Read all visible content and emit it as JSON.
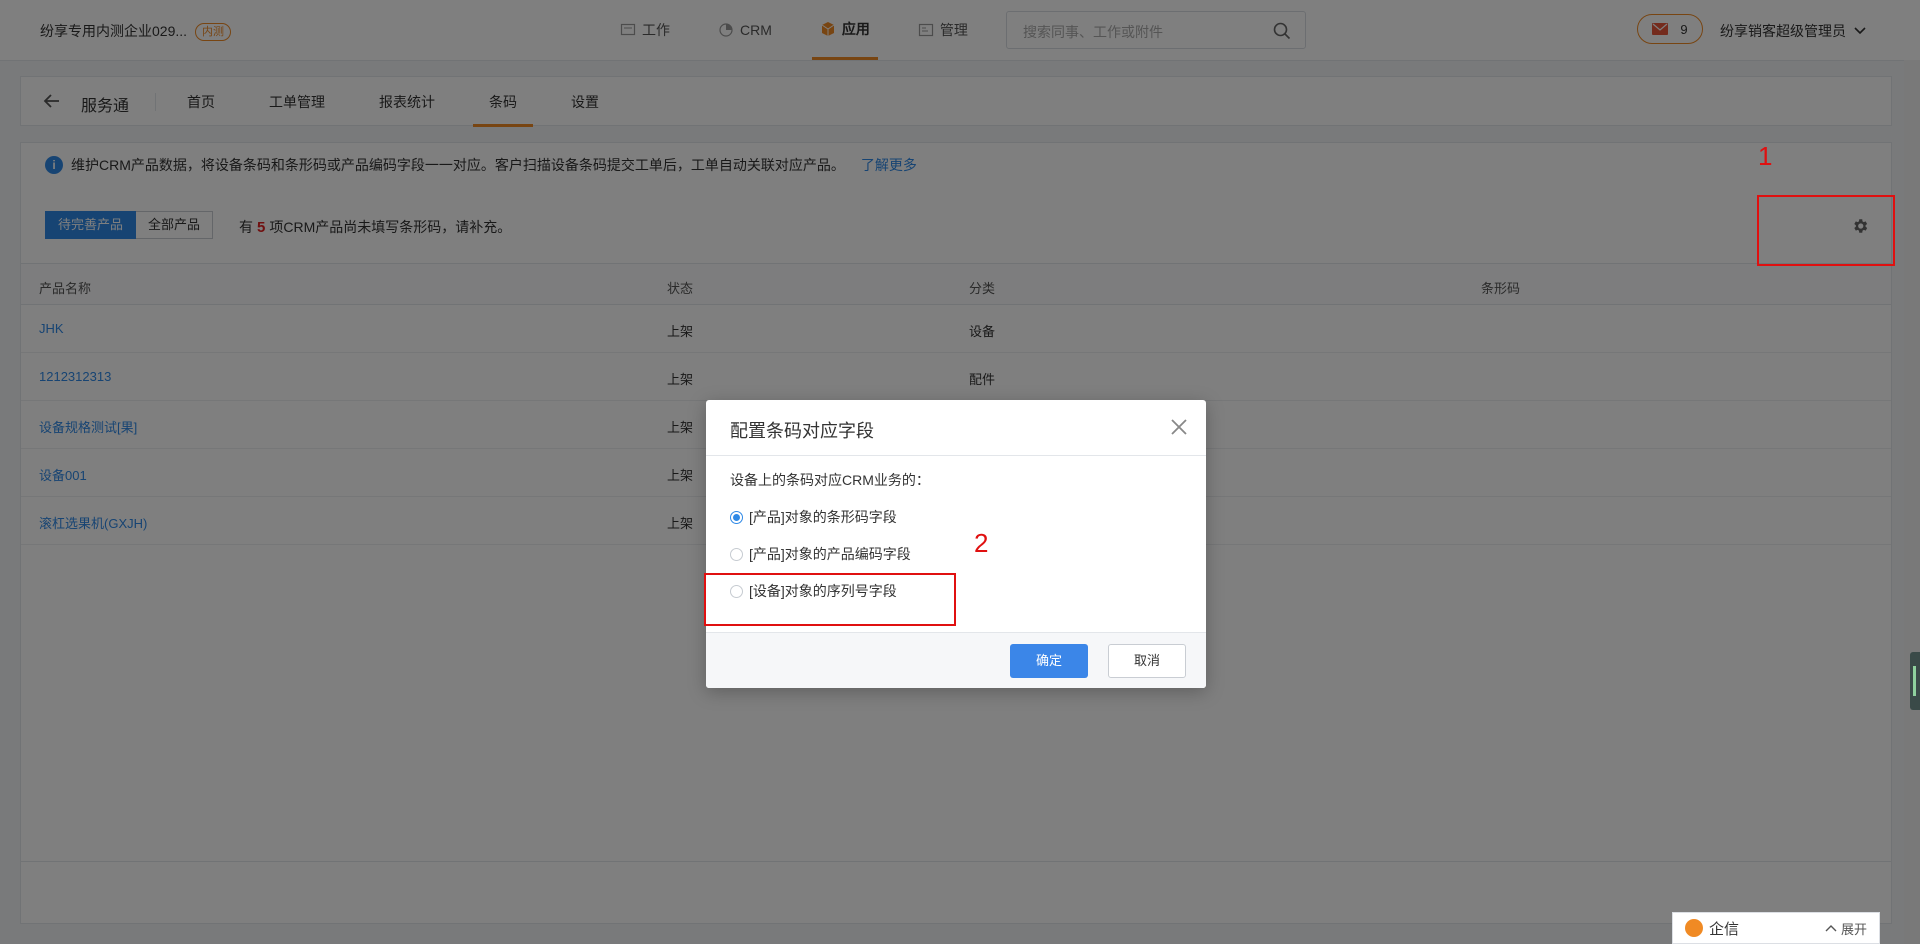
{
  "topbar": {
    "company": "纷享专用内测企业029...",
    "company_tag": "内测",
    "nav": [
      {
        "label": "工作",
        "icon": "work-icon"
      },
      {
        "label": "CRM",
        "icon": "crm-icon"
      },
      {
        "label": "应用",
        "icon": "apps-cube-icon",
        "active": true
      },
      {
        "label": "管理",
        "icon": "admin-icon"
      }
    ],
    "search_placeholder": "搜索同事、工作或附件",
    "mail_count": "9",
    "user": "纷享销客超级管理员"
  },
  "app": {
    "title": "服务通",
    "tabs": [
      "首页",
      "工单管理",
      "报表统计",
      "条码",
      "设置"
    ],
    "active_tab": "条码"
  },
  "info": {
    "text": "维护CRM产品数据，将设备条码和条形码或产品编码字段一一对应。客户扫描设备条码提交工单后，工单自动关联对应产品。",
    "link": "了解更多"
  },
  "filter": {
    "pending": "待完善产品",
    "all": "全部产品",
    "hint_prefix": "有",
    "hint_count": "5",
    "hint_suffix": "项CRM产品尚未填写条形码，请补充。"
  },
  "table": {
    "headers": [
      "产品名称",
      "状态",
      "分类",
      "条形码"
    ],
    "rows": [
      {
        "name": "JHK",
        "status": "上架",
        "category": "设备",
        "barcode": ""
      },
      {
        "name": "1212312313",
        "status": "上架",
        "category": "配件",
        "barcode": ""
      },
      {
        "name": "设备规格测试[果]",
        "status": "上架",
        "category": "",
        "barcode": ""
      },
      {
        "name": "设备001",
        "status": "上架",
        "category": "",
        "barcode": ""
      },
      {
        "name": "滚杠选果机(GXJH)",
        "status": "上架",
        "category": "",
        "barcode": ""
      }
    ]
  },
  "dialog": {
    "title": "配置条码对应字段",
    "lead": "设备上的条码对应CRM业务的：",
    "options": [
      {
        "label": "[产品]对象的条形码字段",
        "selected": true
      },
      {
        "label": "[产品]对象的产品编码字段",
        "selected": false
      },
      {
        "label": "[设备]对象的序列号字段",
        "selected": false
      }
    ],
    "ok": "确定",
    "cancel": "取消"
  },
  "annotations": [
    "1",
    "2"
  ],
  "chat": {
    "label": "企信",
    "expand": "展开"
  },
  "colors": {
    "accent": "#f08a24",
    "primary": "#2f89e6",
    "annotation": "#e01010"
  }
}
